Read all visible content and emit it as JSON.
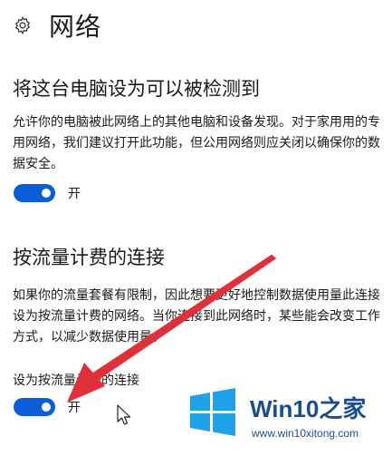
{
  "header": {
    "title": "网络",
    "icon": "gear-icon"
  },
  "discovery": {
    "title": "将这台电脑设为可以被检测到",
    "description": "允许你的电脑被此网络上的其他电脑和设备发现。对于家用用的专用网络，我们建议打开此功能，但公用网络则应关闭以确保你的数据安全。",
    "toggle_state_label": "开",
    "toggle_on": true
  },
  "metered": {
    "title": "按流量计费的连接",
    "description": "如果你的流量套餐有限制，因此想要更好地控制数据使用量此连接设为按流量计费的网络。当你连接到此网络时，某些能会改变工作方式，以减少数据使用量。",
    "field_label": "设为按流量计费的连接",
    "toggle_state_label": "开",
    "toggle_on": true
  },
  "colors": {
    "toggle_on": "#0a5fd6",
    "annotation_arrow": "#e0303a",
    "watermark_blue": "#1a4d8f",
    "windows_logo": "#1fa3e8"
  },
  "watermark": {
    "title": "Win10之家",
    "url": "www.win10xitong.com"
  }
}
